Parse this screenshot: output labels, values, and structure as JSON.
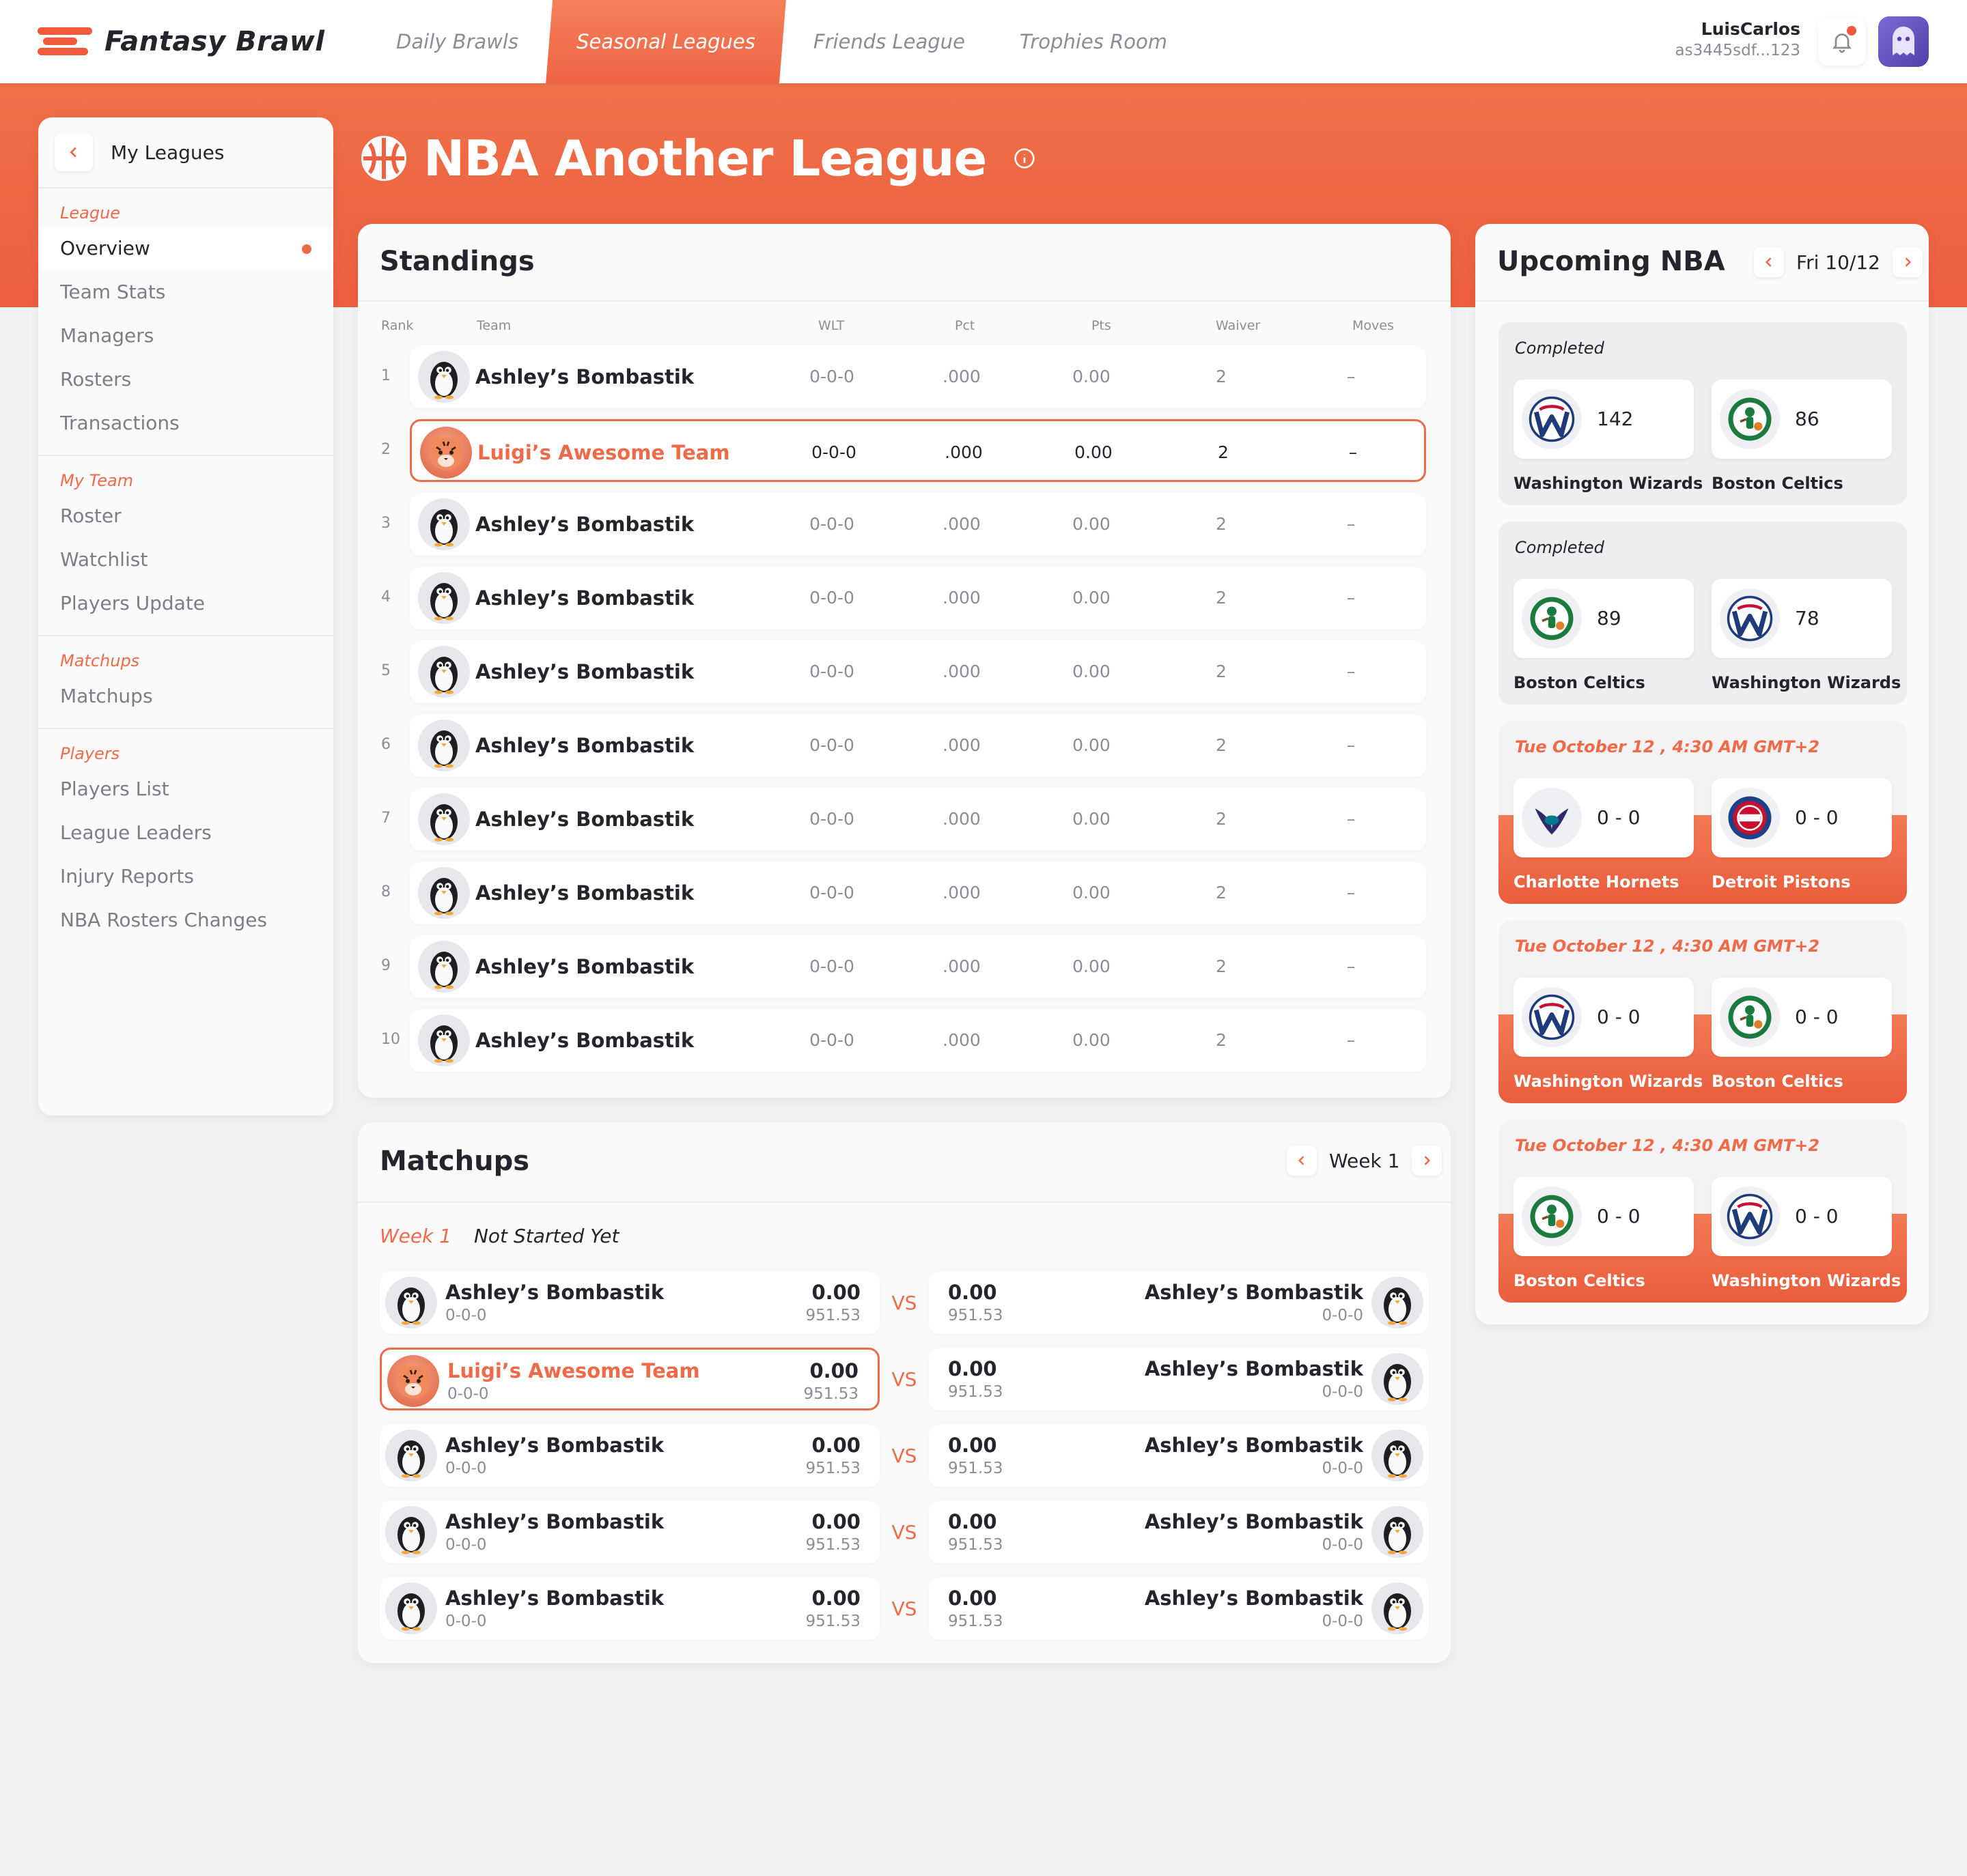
{
  "app": {
    "name": "Fantasy Brawl"
  },
  "nav": {
    "tabs": [
      "Daily Brawls",
      "Seasonal Leagues",
      "Friends League",
      "Trophies Room"
    ]
  },
  "user": {
    "name": "LuisCarlos",
    "id": "as3445sdf...123"
  },
  "sidebar": {
    "title": "My Leagues",
    "sections": [
      {
        "label": "League",
        "items": [
          "Overview",
          "Team Stats",
          "Managers",
          "Rosters",
          "Transactions"
        ]
      },
      {
        "label": "My Team",
        "items": [
          "Roster",
          "Watchlist",
          "Players Update"
        ]
      },
      {
        "label": "Matchups",
        "items": [
          "Matchups"
        ]
      },
      {
        "label": "Players",
        "items": [
          "Players List",
          "League Leaders",
          "Injury Reports",
          "NBA Rosters Changes"
        ]
      }
    ]
  },
  "league": {
    "title": "NBA Another League"
  },
  "standings": {
    "title": "Standings",
    "headers": [
      "Rank",
      "Team",
      "WLT",
      "Pct",
      "Pts",
      "Waiver",
      "Moves"
    ],
    "rows": [
      {
        "rank": "1",
        "team": "Ashley’s Bombastik",
        "wlt": "0-0-0",
        "pct": ".000",
        "pts": "0.00",
        "waiver": "2",
        "moves": "–"
      },
      {
        "rank": "2",
        "team": "Luigi’s Awesome Team",
        "wlt": "0-0-0",
        "pct": ".000",
        "pts": "0.00",
        "waiver": "2",
        "moves": "–"
      },
      {
        "rank": "3",
        "team": "Ashley’s Bombastik",
        "wlt": "0-0-0",
        "pct": ".000",
        "pts": "0.00",
        "waiver": "2",
        "moves": "–"
      },
      {
        "rank": "4",
        "team": "Ashley’s Bombastik",
        "wlt": "0-0-0",
        "pct": ".000",
        "pts": "0.00",
        "waiver": "2",
        "moves": "–"
      },
      {
        "rank": "5",
        "team": "Ashley’s Bombastik",
        "wlt": "0-0-0",
        "pct": ".000",
        "pts": "0.00",
        "waiver": "2",
        "moves": "–"
      },
      {
        "rank": "6",
        "team": "Ashley’s Bombastik",
        "wlt": "0-0-0",
        "pct": ".000",
        "pts": "0.00",
        "waiver": "2",
        "moves": "–"
      },
      {
        "rank": "7",
        "team": "Ashley’s Bombastik",
        "wlt": "0-0-0",
        "pct": ".000",
        "pts": "0.00",
        "waiver": "2",
        "moves": "–"
      },
      {
        "rank": "8",
        "team": "Ashley’s Bombastik",
        "wlt": "0-0-0",
        "pct": ".000",
        "pts": "0.00",
        "waiver": "2",
        "moves": "–"
      },
      {
        "rank": "9",
        "team": "Ashley’s Bombastik",
        "wlt": "0-0-0",
        "pct": ".000",
        "pts": "0.00",
        "waiver": "2",
        "moves": "–"
      },
      {
        "rank": "10",
        "team": "Ashley’s Bombastik",
        "wlt": "0-0-0",
        "pct": ".000",
        "pts": "0.00",
        "waiver": "2",
        "moves": "–"
      }
    ]
  },
  "matchups": {
    "title": "Matchups",
    "week_label": "Week 1",
    "week": "Week 1",
    "status": "Not Started Yet",
    "vs": "VS",
    "rows": [
      {
        "left_team": "Ashley’s Bombastik",
        "left_record": "0-0-0",
        "left_score": "0.00",
        "left_proj": "951.53",
        "right_team": "Ashley’s Bombastik",
        "right_record": "0-0-0",
        "right_score": "0.00",
        "right_proj": "951.53"
      },
      {
        "left_team": "Luigi’s Awesome Team",
        "left_record": "0-0-0",
        "left_score": "0.00",
        "left_proj": "951.53",
        "right_team": "Ashley’s Bombastik",
        "right_record": "0-0-0",
        "right_score": "0.00",
        "right_proj": "951.53"
      },
      {
        "left_team": "Ashley’s Bombastik",
        "left_record": "0-0-0",
        "left_score": "0.00",
        "left_proj": "951.53",
        "right_team": "Ashley’s Bombastik",
        "right_record": "0-0-0",
        "right_score": "0.00",
        "right_proj": "951.53"
      },
      {
        "left_team": "Ashley’s Bombastik",
        "left_record": "0-0-0",
        "left_score": "0.00",
        "left_proj": "951.53",
        "right_team": "Ashley’s Bombastik",
        "right_record": "0-0-0",
        "right_score": "0.00",
        "right_proj": "951.53"
      },
      {
        "left_team": "Ashley’s Bombastik",
        "left_record": "0-0-0",
        "left_score": "0.00",
        "left_proj": "951.53",
        "right_team": "Ashley’s Bombastik",
        "right_record": "0-0-0",
        "right_score": "0.00",
        "right_proj": "951.53"
      }
    ]
  },
  "upcoming": {
    "title": "Upcoming NBA",
    "date": "Fri 10/12",
    "games": [
      {
        "status": "Completed",
        "home": "Washington Wizards",
        "home_score": "142",
        "away": "Boston Celtics",
        "away_score": "86"
      },
      {
        "status": "Completed",
        "home": "Boston Celtics",
        "home_score": "89",
        "away": "Washington Wizards",
        "away_score": "78"
      },
      {
        "status": "Tue October 12 , 4:30 AM GMT+2",
        "home": "Charlotte Hornets",
        "home_score": "0 - 0",
        "away": "Detroit Pistons",
        "away_score": "0 - 0"
      },
      {
        "status": "Tue October 12 , 4:30 AM GMT+2",
        "home": "Washington Wizards",
        "home_score": "0 - 0",
        "away": "Boston Celtics",
        "away_score": "0 - 0"
      },
      {
        "status": "Tue October 12 , 4:30 AM GMT+2",
        "home": "Boston Celtics",
        "home_score": "0 - 0",
        "away": "Washington Wizards",
        "away_score": "0 - 0"
      }
    ]
  },
  "colors": {
    "accent": "#ee6a48",
    "wizards": "#1f3b7a",
    "celtics": "#1b7a3e",
    "hornets": "#2f2a6b",
    "pistons": "#c8102e"
  }
}
